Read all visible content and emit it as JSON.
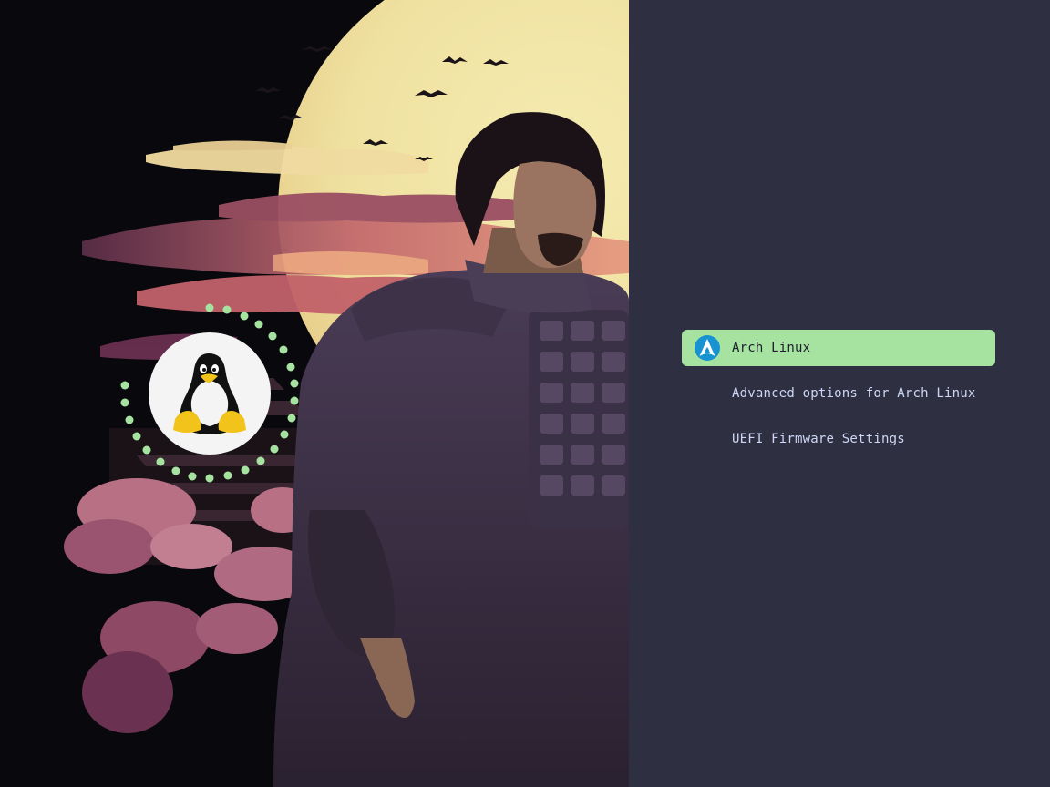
{
  "boot_menu": {
    "selected_index": 0,
    "entries": [
      {
        "label": "Arch Linux",
        "icon": "arch-linux-icon"
      },
      {
        "label": "Advanced options for Arch Linux",
        "icon": ""
      },
      {
        "label": "UEFI Firmware Settings",
        "icon": ""
      }
    ]
  },
  "colors": {
    "panel_background": "#2f2f42",
    "selection_background": "#a6e3a1",
    "entry_text": "#cdd6f4",
    "selected_text": "#1e1e2e",
    "arch_logo": "#1793d1",
    "progress_dots": "#a6e3a1",
    "moon": "#efe5a5"
  },
  "artwork": {
    "icon": "tux-penguin-icon",
    "progress_ring": "dotted-ring"
  }
}
